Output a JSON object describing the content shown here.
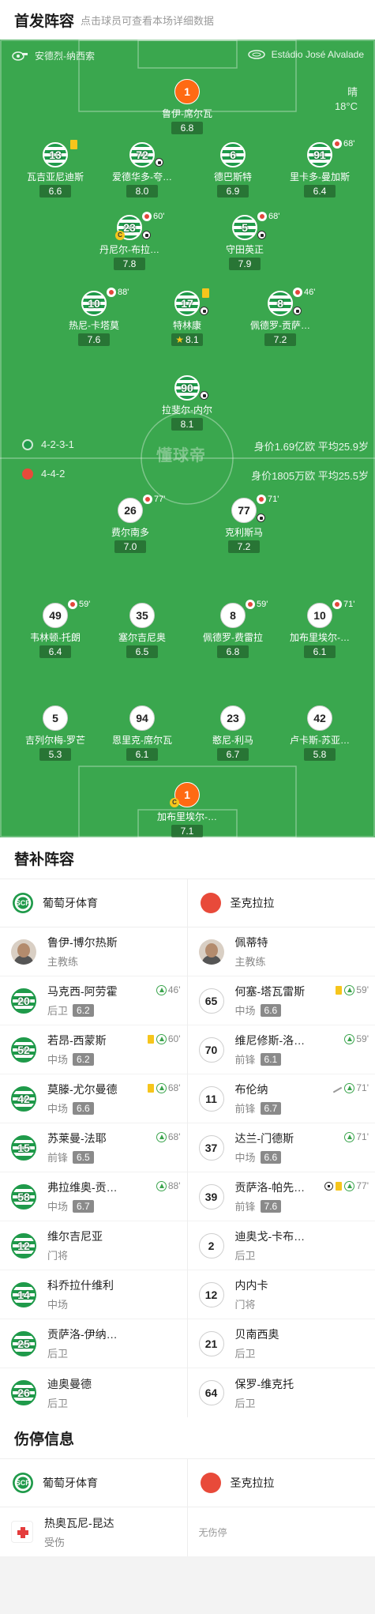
{
  "lineup": {
    "title": "首发阵容",
    "subtitle": "点击球员可查看本场详细数据"
  },
  "pitch": {
    "coach_home": "安德烈-纳西索",
    "stadium": "Estádio José Alvalade",
    "weather": "晴",
    "temperature": "18°C",
    "home_formation": "4-2-3-1",
    "home_value": "身价1.69亿欧 平均25.9岁",
    "away_formation": "4-4-2",
    "away_value": "身价1805万欧 平均25.5岁",
    "watermark": "懂球帝",
    "home_players": [
      {
        "no": "1",
        "name": "鲁伊-席尔瓦",
        "rating": "6.8",
        "gk": true
      },
      {
        "no": "13",
        "name": "瓦吉亚尼迪斯",
        "rating": "6.6"
      },
      {
        "no": "72",
        "name": "爱德华多-夸…",
        "rating": "8.0"
      },
      {
        "no": "6",
        "name": "德巴斯特",
        "rating": "6.9"
      },
      {
        "no": "91",
        "name": "里卡多-曼加斯",
        "rating": "6.4",
        "sub": "68'"
      },
      {
        "no": "23",
        "name": "丹尼尔-布拉…",
        "rating": "7.8",
        "sub": "60'"
      },
      {
        "no": "5",
        "name": "守田英正",
        "rating": "7.9",
        "sub": "68'"
      },
      {
        "no": "10",
        "name": "热尼-卡塔莫",
        "rating": "7.6",
        "sub": "88'"
      },
      {
        "no": "17",
        "name": "特林康",
        "rating": "8.1"
      },
      {
        "no": "8",
        "name": "佩德罗-贡萨…",
        "rating": "7.2",
        "sub": "46'"
      },
      {
        "no": "90",
        "name": "拉斐尔-内尔",
        "rating": "8.1"
      }
    ],
    "away_players": [
      {
        "no": "26",
        "name": "费尔南多",
        "rating": "7.0",
        "sub": "77'"
      },
      {
        "no": "77",
        "name": "克利斯马",
        "rating": "7.2",
        "sub": "71'"
      },
      {
        "no": "49",
        "name": "韦林顿-托朗",
        "rating": "6.4",
        "sub": "59'"
      },
      {
        "no": "35",
        "name": "塞尔吉尼奥",
        "rating": "6.5"
      },
      {
        "no": "8",
        "name": "佩德罗-费雷拉",
        "rating": "6.8",
        "sub": "59'"
      },
      {
        "no": "10",
        "name": "加布里埃尔-…",
        "rating": "6.1",
        "sub": "71'"
      },
      {
        "no": "5",
        "name": "吉列尔梅-罗芒",
        "rating": "5.3"
      },
      {
        "no": "94",
        "name": "恩里克-席尔瓦",
        "rating": "6.1"
      },
      {
        "no": "23",
        "name": "憨尼-利马",
        "rating": "6.7"
      },
      {
        "no": "42",
        "name": "卢卡斯-苏亚…",
        "rating": "5.8"
      },
      {
        "no": "1",
        "name": "加布里埃尔-…",
        "rating": "7.1",
        "gk": true
      }
    ]
  },
  "subs": {
    "title": "替补阵容",
    "home_team": "葡萄牙体育",
    "away_team": "圣克拉拉",
    "home_logo_text": "SCP",
    "home_coach": {
      "name": "鲁伊-博尔热斯",
      "role": "主教练"
    },
    "away_coach": {
      "name": "佩蒂特",
      "role": "主教练"
    },
    "home": [
      {
        "no": "20",
        "name": "马克西-阿劳霍",
        "pos": "后卫",
        "rating": "6.2",
        "min": "46'"
      },
      {
        "no": "52",
        "name": "若昂-西蒙斯",
        "pos": "中场",
        "rating": "6.2",
        "min": "60'"
      },
      {
        "no": "42",
        "name": "莫滕-尤尔曼德",
        "pos": "中场",
        "rating": "6.6",
        "min": "68'"
      },
      {
        "no": "15",
        "name": "苏莱曼-法耶",
        "pos": "前锋",
        "rating": "6.5",
        "min": "68'"
      },
      {
        "no": "58",
        "name": "弗拉维奥-贡…",
        "pos": "中场",
        "rating": "6.7",
        "min": "88'"
      },
      {
        "no": "12",
        "name": "维尔吉尼亚",
        "pos": "门将"
      },
      {
        "no": "14",
        "name": "科乔拉什维利",
        "pos": "中场"
      },
      {
        "no": "25",
        "name": "贡萨洛-伊纳…",
        "pos": "后卫"
      },
      {
        "no": "26",
        "name": "迪奥曼德",
        "pos": "后卫"
      }
    ],
    "away": [
      {
        "no": "65",
        "name": "何塞-塔瓦雷斯",
        "pos": "中场",
        "rating": "6.6",
        "min": "59'"
      },
      {
        "no": "70",
        "name": "维尼修斯-洛…",
        "pos": "前锋",
        "rating": "6.1",
        "min": "59'"
      },
      {
        "no": "11",
        "name": "布伦纳",
        "pos": "前锋",
        "rating": "6.7",
        "min": "71'"
      },
      {
        "no": "37",
        "name": "达兰-门德斯",
        "pos": "中场",
        "rating": "6.6",
        "min": "71'"
      },
      {
        "no": "39",
        "name": "贡萨洛-帕先…",
        "pos": "前锋",
        "rating": "7.6",
        "min": "77'"
      },
      {
        "no": "2",
        "name": "迪奥戈-卡布…",
        "pos": "后卫"
      },
      {
        "no": "12",
        "name": "内内卡",
        "pos": "门将"
      },
      {
        "no": "21",
        "name": "贝南西奥",
        "pos": "后卫"
      },
      {
        "no": "64",
        "name": "保罗-维克托",
        "pos": "后卫"
      }
    ]
  },
  "injuries": {
    "title": "伤停信息",
    "home_player": {
      "name": "热奥瓦尼-昆达",
      "reason": "受伤"
    },
    "away_none": "无伤停"
  }
}
